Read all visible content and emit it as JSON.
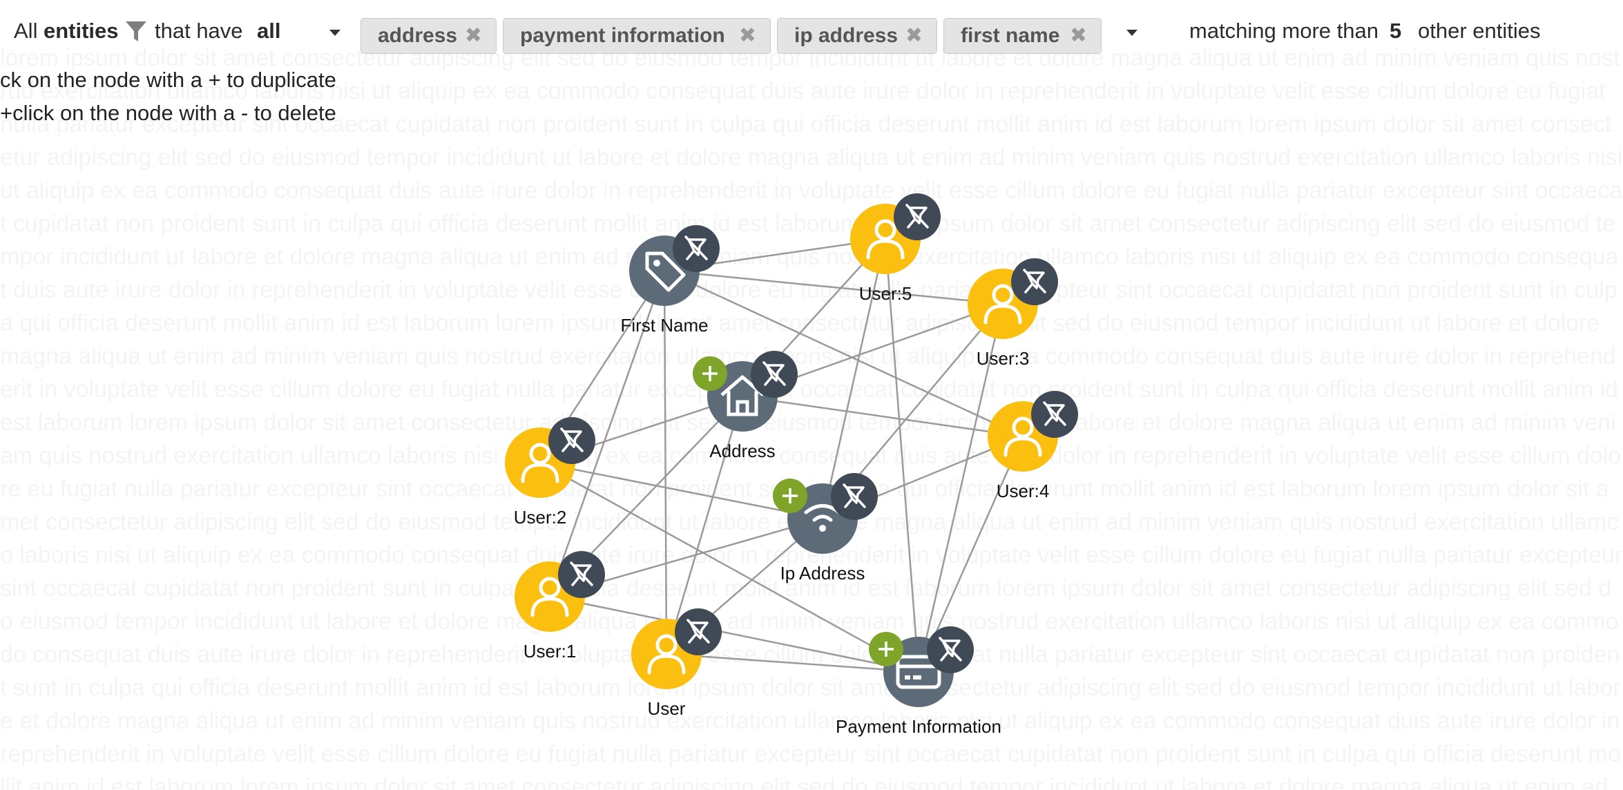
{
  "filter": {
    "prefix": "All",
    "entities_word": "entities",
    "that_have": "that have",
    "mode": "all",
    "tags": [
      {
        "label": "address",
        "remove": "✖"
      },
      {
        "label": "payment information",
        "remove": "✖"
      },
      {
        "label": "ip address",
        "remove": "✖"
      },
      {
        "label": "first name",
        "remove": "✖"
      }
    ],
    "matching_label": "matching more than",
    "count": "5",
    "suffix": "other entities"
  },
  "instructions": {
    "line1": "ck on the node with a + to duplicate",
    "line2": "+click on the node with a - to delete"
  },
  "background_text": "lorem ipsum dolor sit amet consectetur adipiscing elit sed do eiusmod tempor incididunt ut labore et dolore magna aliqua ut enim ad minim veniam quis nostrud exercitation ullamco laboris nisi ut aliquip ex ea commodo consequat duis aute irure dolor in reprehenderit in voluptate velit esse cillum dolore eu fugiat nulla pariatur excepteur sint occaecat cupidatat non proident sunt in culpa qui officia deserunt mollit anim id est laborum",
  "colors": {
    "user_node": "#fbbf0f",
    "attribute_node": "#5c6b77",
    "pin_badge": "#3f4a56",
    "plus_badge": "#7ea52a",
    "edge": "#9a9a9a"
  },
  "graph": {
    "nodes": [
      {
        "id": "first_name",
        "label": "First Name",
        "kind": "attribute",
        "icon": "tag-icon",
        "plus": false
      },
      {
        "id": "address",
        "label": "Address",
        "kind": "attribute",
        "icon": "home-icon",
        "plus": true
      },
      {
        "id": "ip_address",
        "label": "Ip Address",
        "kind": "attribute",
        "icon": "wifi-icon",
        "plus": true
      },
      {
        "id": "payment_information",
        "label": "Payment Information",
        "kind": "attribute",
        "icon": "credit-card-icon",
        "plus": true
      },
      {
        "id": "user5",
        "label": "User:5",
        "kind": "user",
        "icon": "user-icon",
        "plus": false
      },
      {
        "id": "user3",
        "label": "User:3",
        "kind": "user",
        "icon": "user-icon",
        "plus": false
      },
      {
        "id": "user4",
        "label": "User:4",
        "kind": "user",
        "icon": "user-icon",
        "plus": false
      },
      {
        "id": "user2",
        "label": "User:2",
        "kind": "user",
        "icon": "user-icon",
        "plus": false
      },
      {
        "id": "user1",
        "label": "User:1",
        "kind": "user",
        "icon": "user-icon",
        "plus": false
      },
      {
        "id": "user",
        "label": "User",
        "kind": "user",
        "icon": "user-icon",
        "plus": false
      }
    ],
    "edges": [
      [
        "first_name",
        "user5"
      ],
      [
        "first_name",
        "user3"
      ],
      [
        "first_name",
        "user4"
      ],
      [
        "first_name",
        "user2"
      ],
      [
        "first_name",
        "user1"
      ],
      [
        "first_name",
        "user"
      ],
      [
        "address",
        "user5"
      ],
      [
        "address",
        "user3"
      ],
      [
        "address",
        "user4"
      ],
      [
        "address",
        "user2"
      ],
      [
        "address",
        "user1"
      ],
      [
        "address",
        "user"
      ],
      [
        "ip_address",
        "user5"
      ],
      [
        "ip_address",
        "user3"
      ],
      [
        "ip_address",
        "user4"
      ],
      [
        "ip_address",
        "user2"
      ],
      [
        "ip_address",
        "user1"
      ],
      [
        "ip_address",
        "user"
      ],
      [
        "payment_information",
        "user5"
      ],
      [
        "payment_information",
        "user3"
      ],
      [
        "payment_information",
        "user4"
      ],
      [
        "payment_information",
        "user2"
      ],
      [
        "payment_information",
        "user1"
      ],
      [
        "payment_information",
        "user"
      ]
    ]
  }
}
